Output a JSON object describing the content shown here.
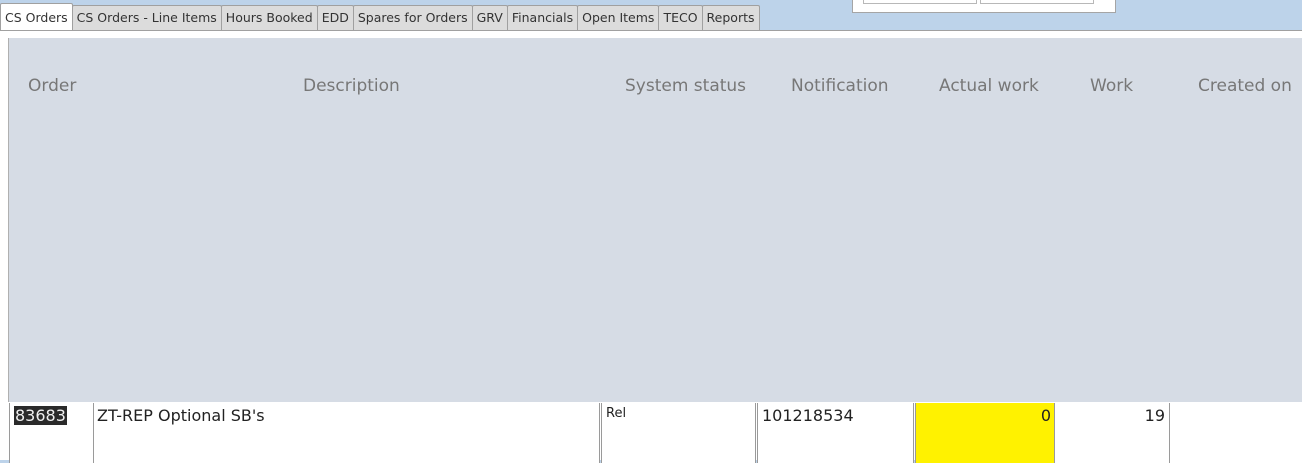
{
  "tabs": [
    {
      "label": "CS Orders",
      "active": true
    },
    {
      "label": "CS Orders - Line Items",
      "active": false
    },
    {
      "label": "Hours Booked",
      "active": false
    },
    {
      "label": "EDD",
      "active": false
    },
    {
      "label": "Spares for Orders",
      "active": false
    },
    {
      "label": "GRV",
      "active": false
    },
    {
      "label": "Financials",
      "active": false
    },
    {
      "label": "Open Items",
      "active": false
    },
    {
      "label": "TECO",
      "active": false
    },
    {
      "label": "Reports",
      "active": false
    }
  ],
  "columns": {
    "order": "Order",
    "description": "Description",
    "system_status": "System status",
    "notification": "Notification",
    "actual_work": "Actual work",
    "work": "Work",
    "created_on": "Created on"
  },
  "row": {
    "order": "83683",
    "description": "ZT-REP Optional SB's",
    "system_status": "Rel",
    "notification": "101218534",
    "actual_work": "0",
    "work": "19",
    "created_on": ""
  },
  "colors": {
    "window_bg": "#bdd3ea",
    "header_band": "#d6dce5",
    "actual_work_highlight": "#fff200"
  }
}
